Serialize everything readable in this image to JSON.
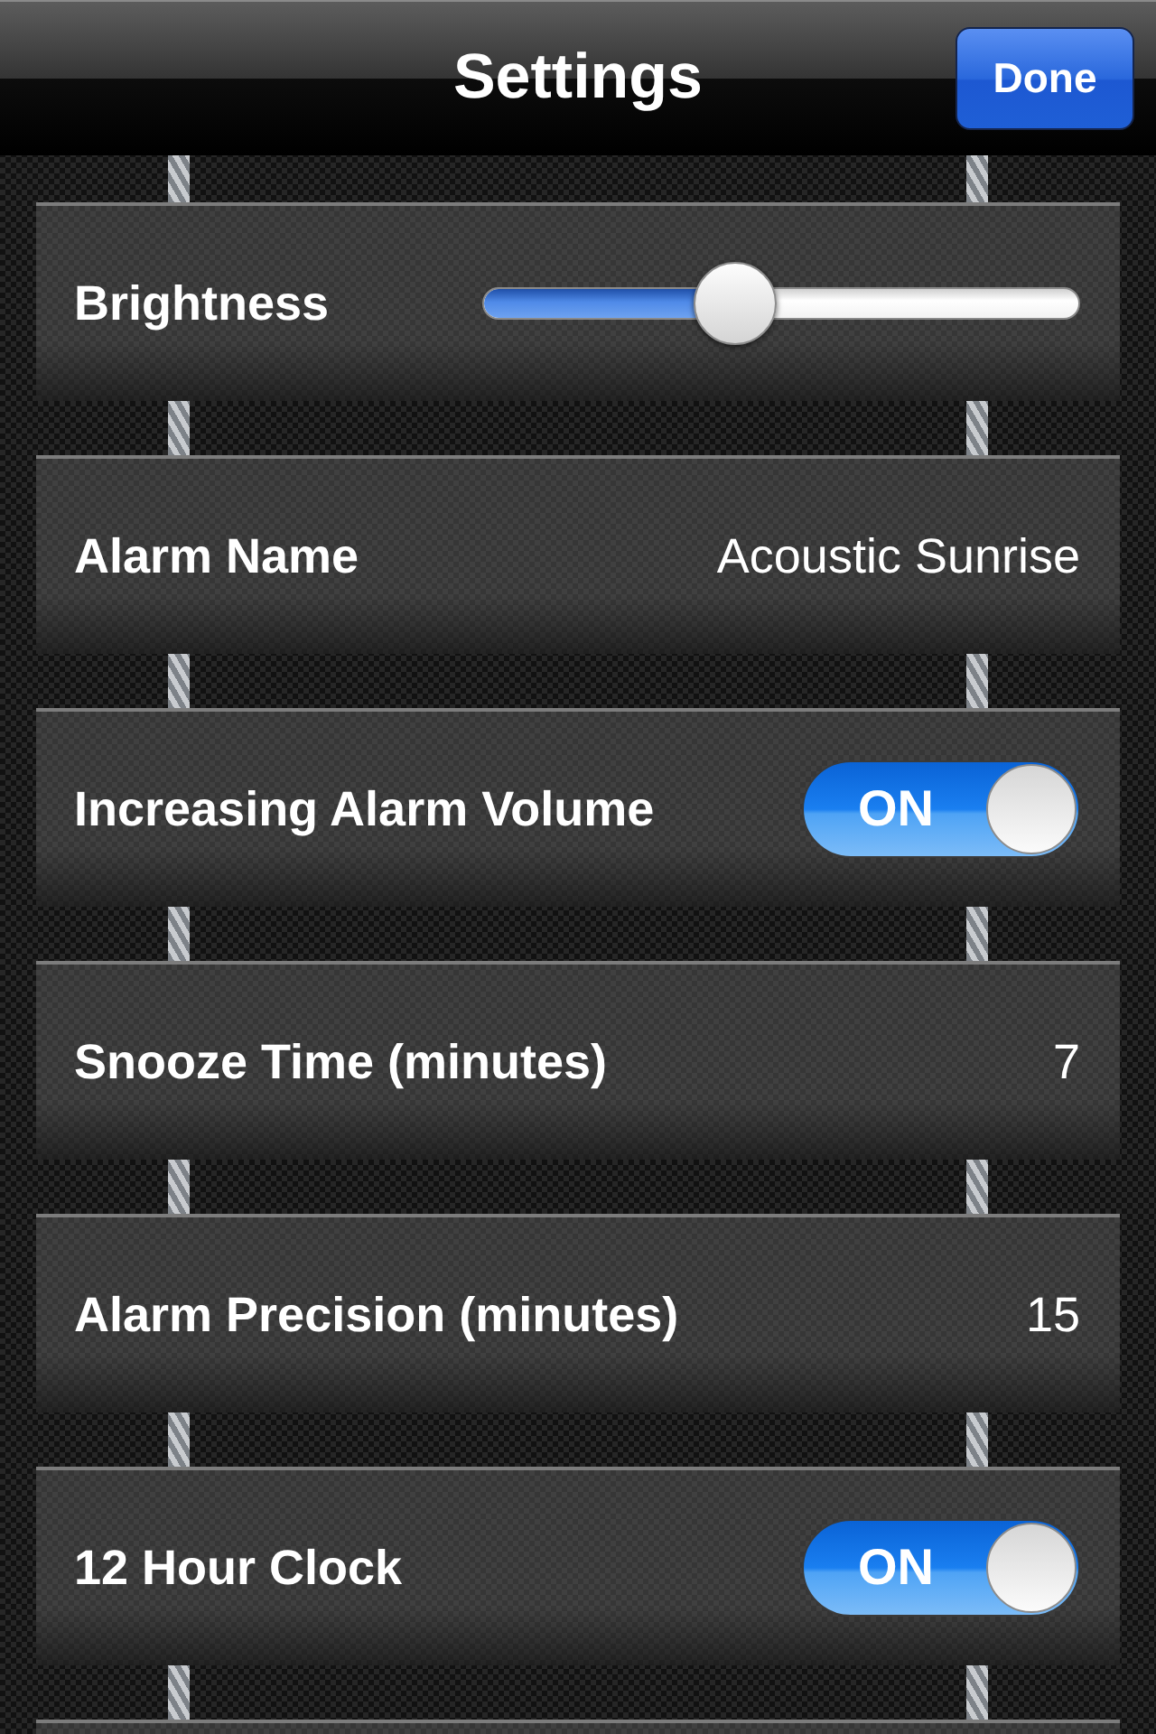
{
  "nav_bar": {
    "title": "Settings",
    "done_button": "Done"
  },
  "rows": [
    {
      "kind": "slider",
      "label": "Brightness",
      "level": 0.41
    },
    {
      "kind": "value",
      "label": "Alarm Name",
      "value": "Acoustic Sunrise"
    },
    {
      "kind": "switch",
      "label": "Increasing Alarm Volume",
      "on": true,
      "switch_label": "ON"
    },
    {
      "kind": "value",
      "label": "Snooze Time (minutes)",
      "value": "7"
    },
    {
      "kind": "value",
      "label": "Alarm Precision (minutes)",
      "value": "15"
    },
    {
      "kind": "switch",
      "label": "12 Hour Clock",
      "on": true,
      "switch_label": "ON"
    }
  ]
}
